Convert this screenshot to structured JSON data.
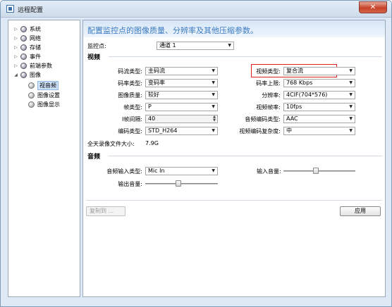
{
  "window": {
    "title": "远程配置",
    "close_label": "✕"
  },
  "tree": {
    "items": [
      {
        "label": "系统",
        "toggle": "▷"
      },
      {
        "label": "网络",
        "toggle": "▷"
      },
      {
        "label": "存储",
        "toggle": "▷"
      },
      {
        "label": "事件",
        "toggle": "▷"
      },
      {
        "label": "前端参数",
        "toggle": "▷"
      },
      {
        "label": "图像",
        "toggle": "◢"
      }
    ],
    "children": [
      {
        "label": "视音频"
      },
      {
        "label": "图像设置"
      },
      {
        "label": "图像显示"
      }
    ]
  },
  "header": {
    "text": "配置监控点的图像质量、分辨率及其他压缩参数。"
  },
  "monitor": {
    "label": "监控点:",
    "value": "通道 1"
  },
  "video": {
    "section_title": "视频",
    "stream_type": {
      "label": "码流类型:",
      "value": "主码流"
    },
    "video_type": {
      "label": "视频类型:",
      "value": "复合流"
    },
    "bitrate_type": {
      "label": "码率类型:",
      "value": "变码率"
    },
    "bitrate_limit": {
      "label": "码率上限:",
      "value": "768 Kbps"
    },
    "image_quality": {
      "label": "图像质量:",
      "value": "较好"
    },
    "resolution": {
      "label": "分辨率:",
      "value": "4CIF(704*576)"
    },
    "frame_type": {
      "label": "帧类型:",
      "value": "P"
    },
    "frame_rate": {
      "label": "视频帧率:",
      "value": "10fps"
    },
    "i_frame_interval": {
      "label": "I帧间隔:",
      "value": "40"
    },
    "audio_encoding": {
      "label": "音频编码类型:",
      "value": "AAC"
    },
    "encoding_type": {
      "label": "编码类型:",
      "value": "STD_H264"
    },
    "complexity": {
      "label": "视频编码复杂度:",
      "value": "中"
    },
    "daily_size": {
      "label": "全天录像文件大小:",
      "value": "7.9G"
    }
  },
  "audio": {
    "section_title": "音频",
    "input_type": {
      "label": "音频输入类型:",
      "value": "Mic In"
    },
    "input_volume": {
      "label": "输入音量:",
      "level_percent": 45
    },
    "output_volume": {
      "label": "输出音量:",
      "level_percent": 45
    }
  },
  "buttons": {
    "copy_to": "复制到 ...",
    "apply": "应用"
  },
  "icons": {
    "dropdown": "dropdown-arrow-icon",
    "spin": "spin-arrows-icon",
    "tree_node": "gear-node-icon"
  }
}
